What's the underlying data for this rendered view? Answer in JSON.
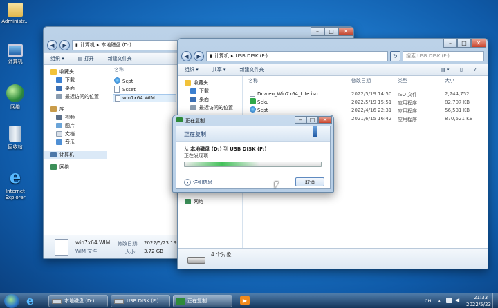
{
  "desktop": {
    "icons": [
      {
        "label": "Administr...",
        "icon": "user-folder-icon"
      },
      {
        "label": "计算机",
        "icon": "computer-icon"
      },
      {
        "label": "网络",
        "icon": "network-globe-icon"
      },
      {
        "label": "回收站",
        "icon": "recycle-bin-icon"
      },
      {
        "label": "Internet Explorer",
        "icon": "internet-explorer-icon"
      }
    ]
  },
  "win1": {
    "breadcrumb": [
      "计算机",
      "本地磁盘 (D:)"
    ],
    "toolbar": {
      "organize": "组织 ▾",
      "open": "打开",
      "new_folder": "新建文件夹"
    },
    "column_name": "名称",
    "nav_items": [
      "收藏夹",
      "下载",
      "桌面",
      "最近访问的位置",
      "库",
      "视频",
      "图片",
      "文档",
      "音乐",
      "计算机",
      "网络"
    ],
    "files": [
      "Scpt",
      "Scset",
      "win7x64.WIM"
    ],
    "details": {
      "filename": "win7x64.WIM",
      "type": "WIM 文件",
      "modified_label": "修改日期:",
      "modified": "2022/5/23 19:01",
      "size_label": "大小:",
      "size": "3.72 GB"
    }
  },
  "win2": {
    "breadcrumb": [
      "计算机",
      "USB DISK (F:)"
    ],
    "search_placeholder": "搜索 USB DISK (F:)",
    "toolbar": {
      "organize": "组织 ▾",
      "share": "共享 ▾",
      "new_folder": "新建文件夹"
    },
    "columns": {
      "name": "名称",
      "modified": "修改日期",
      "type": "类型",
      "size": "大小"
    },
    "nav_items": [
      "收藏夹",
      "下载",
      "桌面",
      "最近访问的位置",
      "网络"
    ],
    "files": [
      {
        "name": "Drvceo_Win7x64_Lite.iso",
        "date": "2022/5/19 14:50",
        "type": "ISO 文件",
        "size": "2,744,752...",
        "icon": "iso-file-icon"
      },
      {
        "name": "Scku",
        "date": "2022/5/19 15:51",
        "type": "应用程序",
        "size": "82,707 KB",
        "icon": "app-green-icon"
      },
      {
        "name": "Scpt",
        "date": "2022/4/16 22:31",
        "type": "应用程序",
        "size": "56,531 KB",
        "icon": "app-blue-icon"
      },
      {
        "name": "",
        "date": "2021/6/15 16:42",
        "type": "应用程序",
        "size": "870,521 KB",
        "icon": "app-icon"
      }
    ],
    "status": "4 个对象"
  },
  "copy_dialog": {
    "title": "正在复制",
    "heading": "正在复制",
    "from_label": "从",
    "from": "本地磁盘 (D:)",
    "to_label": "到",
    "to": "USB DISK (F:)",
    "status": "正在发现项...",
    "details": "详细信息",
    "cancel": "取消",
    "progress": 0.55
  },
  "taskbar": {
    "items": [
      "本地磁盘 (D:)",
      "USB DISK (F:)",
      "正在复制"
    ],
    "lang": "CH",
    "time": "21:33",
    "date": "2022/5/23"
  }
}
